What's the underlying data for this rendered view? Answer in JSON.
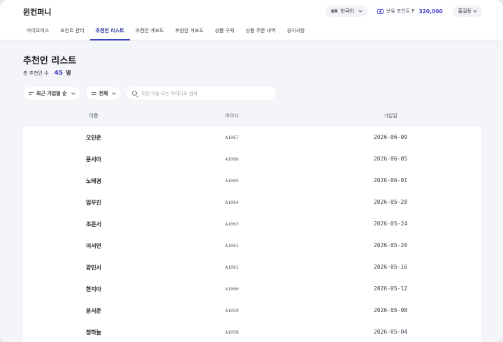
{
  "header": {
    "logo": "윈컨퍼니",
    "lang_code": "KR",
    "lang_label": "한국어",
    "points_label": "보유 포인트 P",
    "points_value": "320,000",
    "user_name": "홍길동"
  },
  "nav": {
    "tabs": [
      {
        "label": "마이오피스"
      },
      {
        "label": "포인트 관리"
      },
      {
        "label": "추천인 리스트",
        "active": true
      },
      {
        "label": "추천인 계보도"
      },
      {
        "label": "후원인 계보도"
      },
      {
        "label": "상품 구매"
      },
      {
        "label": "상품 주문 내역"
      },
      {
        "label": "공지사항"
      }
    ]
  },
  "page": {
    "title": "추천인 리스트",
    "count_label": "총 추천인 수",
    "count_value": "45",
    "count_unit": "명"
  },
  "filters": {
    "sort_label": "최근 가입일 순",
    "scope_label": "전체",
    "search_placeholder": "회원 이름 또는 아이디로 검색"
  },
  "table": {
    "columns": [
      "이름",
      "아이디",
      "가입일"
    ],
    "rows": [
      {
        "name": "오민준",
        "id": "A1067",
        "joined": "2026-06-09"
      },
      {
        "name": "문서아",
        "id": "A1066",
        "joined": "2026-06-05"
      },
      {
        "name": "노태경",
        "id": "A1065",
        "joined": "2026-06-01"
      },
      {
        "name": "임우진",
        "id": "A1064",
        "joined": "2026-05-28"
      },
      {
        "name": "조은서",
        "id": "A1063",
        "joined": "2026-05-24"
      },
      {
        "name": "이서연",
        "id": "A1062",
        "joined": "2026-05-20"
      },
      {
        "name": "강민서",
        "id": "A1061",
        "joined": "2026-05-16"
      },
      {
        "name": "한지아",
        "id": "A1060",
        "joined": "2026-05-12"
      },
      {
        "name": "윤서준",
        "id": "A1059",
        "joined": "2026-05-08"
      },
      {
        "name": "정하늘",
        "id": "A1058",
        "joined": "2026-05-04"
      }
    ]
  },
  "colors": {
    "accent": "#3b3fc2",
    "accent_text": "#4845c8",
    "background": "#f4f5f8"
  }
}
